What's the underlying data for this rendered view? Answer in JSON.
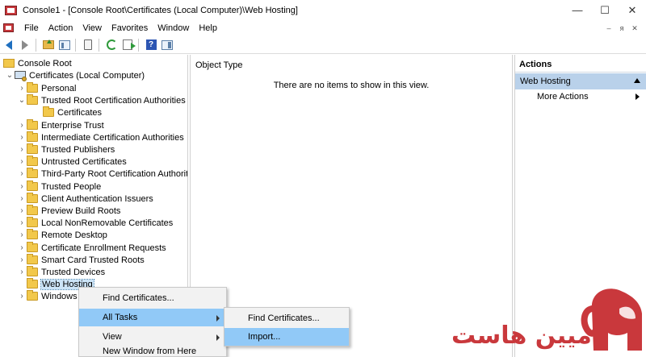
{
  "window": {
    "title": "Console1 - [Console Root\\Certificates (Local Computer)\\Web Hosting]",
    "minimize_glyph": "—",
    "maximize_glyph": "☐",
    "close_glyph": "✕"
  },
  "menubar": {
    "items": [
      "File",
      "Action",
      "View",
      "Favorites",
      "Window",
      "Help"
    ],
    "mdi_minimize": "–",
    "mdi_restore": "ᴙ",
    "mdi_close": "✕"
  },
  "toolbar": {
    "buttons": [
      "back-icon",
      "forward-icon",
      "up-one-level-icon",
      "show-hide-tree-icon",
      "clipboard-icon",
      "refresh-icon",
      "export-list-icon",
      "help-icon",
      "show-hide-action-pane-icon"
    ],
    "help_glyph": "?"
  },
  "tree": {
    "root": "Console Root",
    "certificates": "Certificates (Local Computer)",
    "items": [
      "Personal",
      "Trusted Root Certification Authorities",
      "Certificates",
      "Enterprise Trust",
      "Intermediate Certification Authorities",
      "Trusted Publishers",
      "Untrusted Certificates",
      "Third-Party Root Certification Authorities",
      "Trusted People",
      "Client Authentication Issuers",
      "Preview Build Roots",
      "Local NonRemovable Certificates",
      "Remote Desktop",
      "Certificate Enrollment Requests",
      "Smart Card Trusted Roots",
      "Trusted Devices",
      "Web Hosting",
      "Windows"
    ],
    "collapsed_glyph": "›",
    "expanded_glyph": "⌄"
  },
  "center": {
    "column_header": "Object Type",
    "empty_message": "There are no items to show in this view."
  },
  "actions": {
    "header": "Actions",
    "selected": "Web Hosting",
    "more_actions": "More Actions"
  },
  "context_menu": {
    "items": [
      "Find Certificates...",
      "All Tasks",
      "View",
      "New Window from Here"
    ]
  },
  "submenu": {
    "items": [
      "Find Certificates...",
      "Import..."
    ]
  },
  "watermark": {
    "text": "میین هاست",
    "color": "#c9383c"
  },
  "colors": {
    "selection": "#b9d1ea",
    "menu_highlight": "#91c9f7",
    "folder": "#f2c84b"
  }
}
